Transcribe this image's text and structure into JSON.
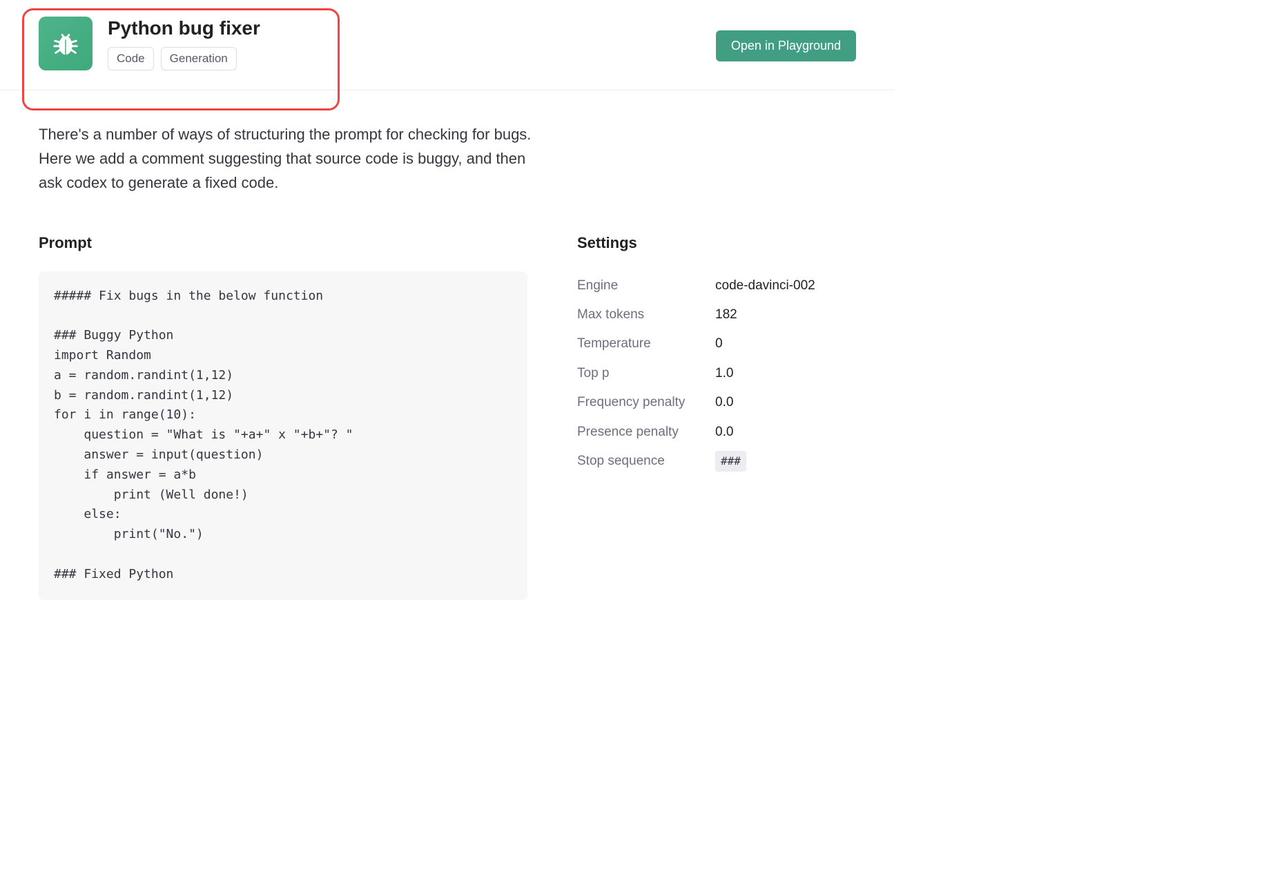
{
  "header": {
    "title": "Python bug fixer",
    "tags": [
      "Code",
      "Generation"
    ],
    "open_button": "Open in Playground",
    "icon_name": "bug"
  },
  "description": "There's a number of ways of structuring the prompt for checking for bugs. Here we add a comment suggesting that source code is buggy, and then ask codex to generate a fixed code.",
  "prompt": {
    "heading": "Prompt",
    "text": "##### Fix bugs in the below function\n\n### Buggy Python\nimport Random\na = random.randint(1,12)\nb = random.randint(1,12)\nfor i in range(10):\n    question = \"What is \"+a+\" x \"+b+\"? \"\n    answer = input(question)\n    if answer = a*b\n        print (Well done!)\n    else:\n        print(\"No.\")\n\n### Fixed Python"
  },
  "settings": {
    "heading": "Settings",
    "rows": [
      {
        "label": "Engine",
        "value": "code-davinci-002",
        "chip": false
      },
      {
        "label": "Max tokens",
        "value": "182",
        "chip": false
      },
      {
        "label": "Temperature",
        "value": "0",
        "chip": false
      },
      {
        "label": "Top p",
        "value": "1.0",
        "chip": false
      },
      {
        "label": "Frequency penalty",
        "value": "0.0",
        "chip": false
      },
      {
        "label": "Presence penalty",
        "value": "0.0",
        "chip": false
      },
      {
        "label": "Stop sequence",
        "value": "###",
        "chip": true
      }
    ]
  },
  "colors": {
    "accent_green": "#419e83",
    "highlight_red": "#ef4444",
    "text_primary": "#202123",
    "text_muted": "#6e6e80",
    "code_bg": "#f7f7f8"
  }
}
